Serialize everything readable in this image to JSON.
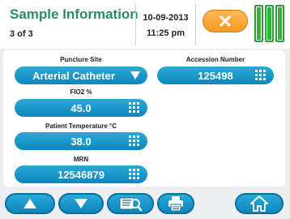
{
  "header": {
    "title": "Sample Information",
    "subtitle": "3 of 3",
    "date": "10-09-2013",
    "time": "11:25 pm"
  },
  "fields": {
    "puncture_site": {
      "label": "Puncture Site",
      "value": "Arterial Catheter"
    },
    "accession_number": {
      "label": "Accession Number",
      "value": "125498"
    },
    "fio2": {
      "label": "FIO2 %",
      "value": "45.0"
    },
    "patient_temperature": {
      "label": "Patient Temperature °C",
      "value": "38.0"
    },
    "mrn": {
      "label": "MRN",
      "value": "12546879"
    }
  },
  "status_bars": {
    "count": 3,
    "level": 1.0
  },
  "icons": {
    "cancel": "close-x-icon",
    "dropdown": "triangle-down-icon",
    "keypad": "keypad-grid-icon",
    "up": "arrow-up-icon",
    "down": "arrow-down-icon",
    "scan": "scan-barcode-icon",
    "print": "printer-icon",
    "home": "home-icon"
  },
  "colors": {
    "title": "#2a8c6e",
    "accent_blue": "#1596c8",
    "cancel_orange": "#f5a533",
    "status_green": "#2db53c"
  }
}
